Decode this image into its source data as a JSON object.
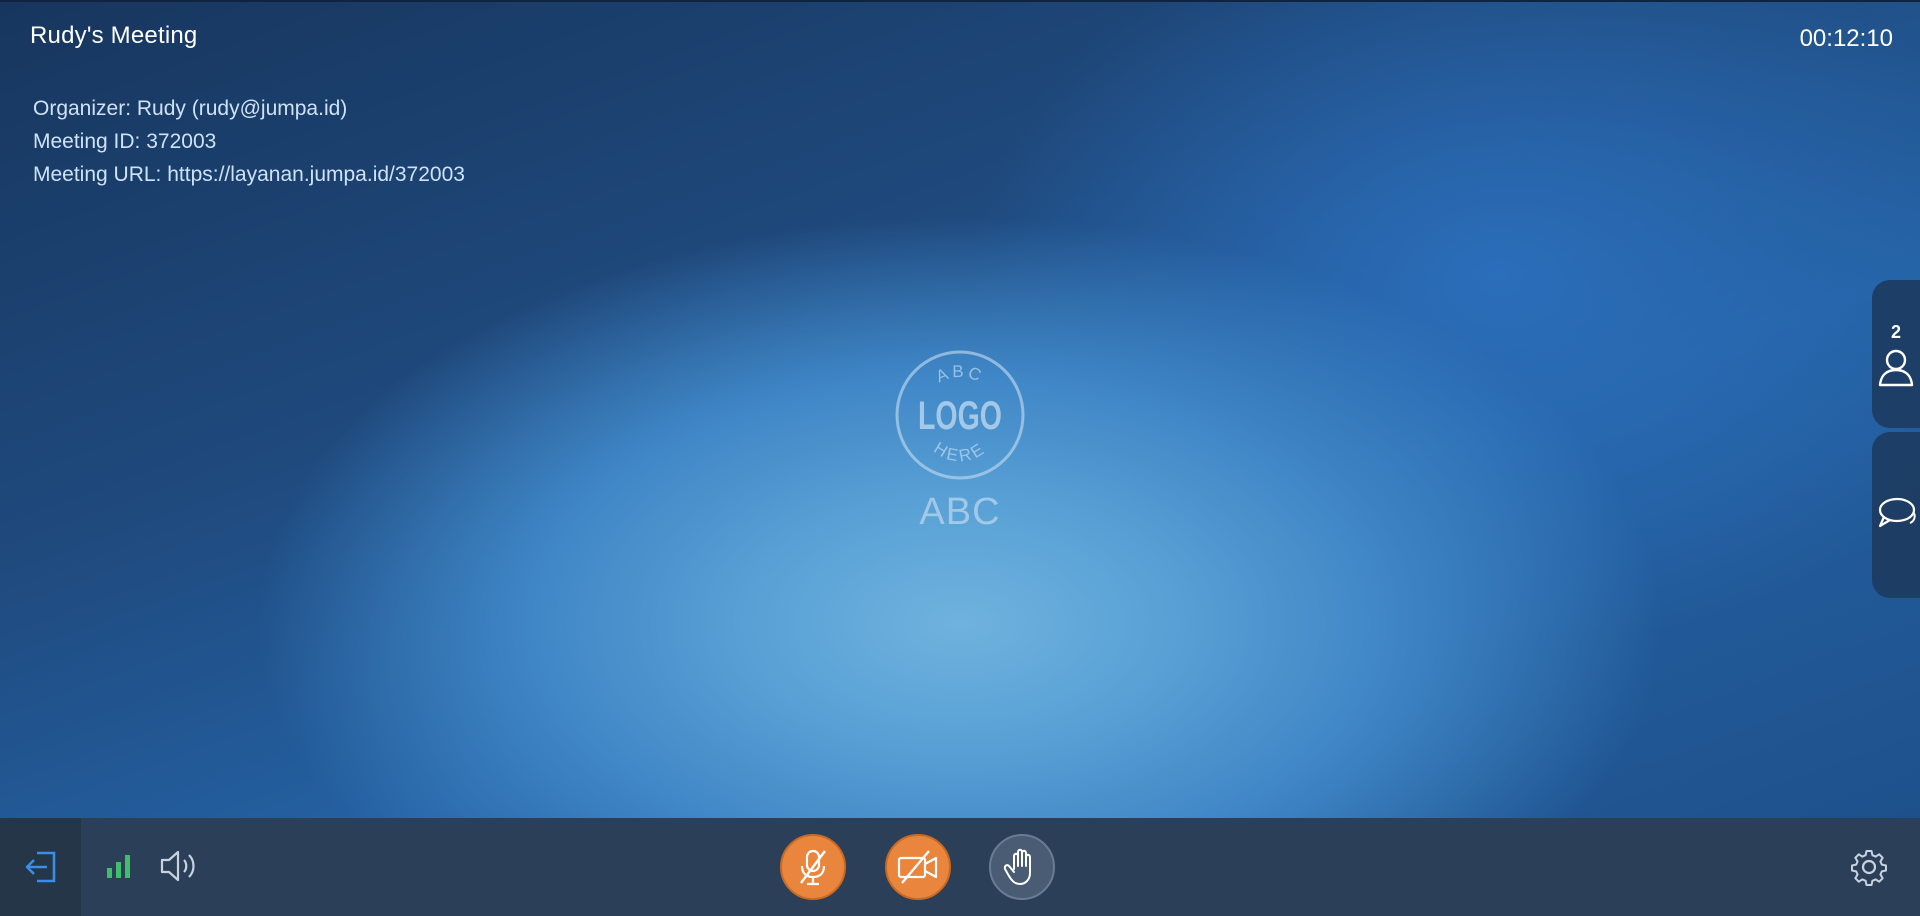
{
  "meeting": {
    "title": "Rudy's Meeting",
    "timer": "00:12:10",
    "info": [
      {
        "label": "Organizer:",
        "value": "Rudy (rudy@jumpa.id)"
      },
      {
        "label": "Meeting ID:",
        "value": "372003"
      },
      {
        "label": "Meeting URL:",
        "value": "https://layanan.jumpa.id/372003"
      }
    ]
  },
  "logo": {
    "top_arc": "ABC",
    "center": "LOGO",
    "bottom_arc": "HERE",
    "caption": "ABC"
  },
  "side_panel": {
    "participant_count": "2",
    "participants_icon": "person-icon",
    "chat_icon": "chat-bubbles-icon"
  },
  "toolbar": {
    "leave_icon": "leave-icon",
    "signal_icon": "signal-bars-icon",
    "speaker_icon": "speaker-icon",
    "mic_icon": "microphone-muted-icon",
    "camera_icon": "camera-off-icon",
    "hand_icon": "raise-hand-icon",
    "settings_icon": "gear-icon"
  },
  "colors": {
    "accent_orange": "#e9853c",
    "leave_blue": "#3a8ee6",
    "signal_green": "#3fbf6a",
    "toolbar_bg": "#2c3f58"
  }
}
